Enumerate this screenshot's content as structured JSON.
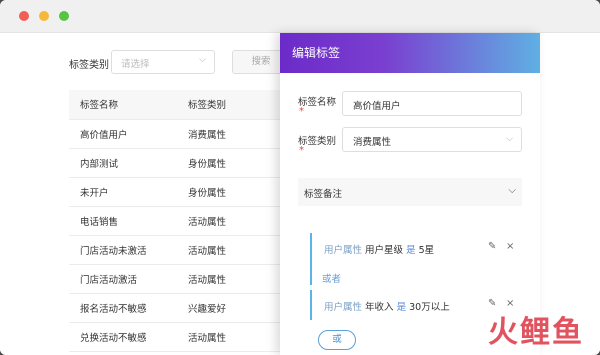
{
  "filter": {
    "label": "标签类别",
    "placeholder": "请选择",
    "search_label": "搜索"
  },
  "table": {
    "headers": [
      "标签名称",
      "标签类别"
    ],
    "rows": [
      [
        "高价值用户",
        "消费属性"
      ],
      [
        "内部测试",
        "身份属性"
      ],
      [
        "未开户",
        "身份属性"
      ],
      [
        "电话销售",
        "活动属性"
      ],
      [
        "门店活动未激活",
        "活动属性"
      ],
      [
        "门店活动激活",
        "活动属性"
      ],
      [
        "报名活动不敏感",
        "兴趣爱好"
      ],
      [
        "兑换活动不敏感",
        "活动属性"
      ]
    ]
  },
  "drawer": {
    "title": "编辑标签",
    "name_label": "标签名称",
    "name_value": "高价值用户",
    "category_label": "标签类别",
    "category_value": "消费属性",
    "required_mark": "*",
    "remark_label": "标签备注",
    "rules": [
      {
        "attr": "用户属性",
        "field": "用户星级",
        "op": "是",
        "value": "5星"
      },
      {
        "attr": "用户属性",
        "field": "年收入",
        "op": "是",
        "value": "30万以上"
      }
    ],
    "or_text": "或者",
    "or_button": "或"
  },
  "icons": {
    "chevron": "chevron-down-icon",
    "edit": "pencil-icon",
    "close": "close-icon"
  },
  "logo_text": "火鲤鱼",
  "colors": {
    "accent": "#5ab4e5",
    "header_start": "#6c2bc9",
    "header_end": "#5fb0e3",
    "logo": "#e0535f"
  }
}
